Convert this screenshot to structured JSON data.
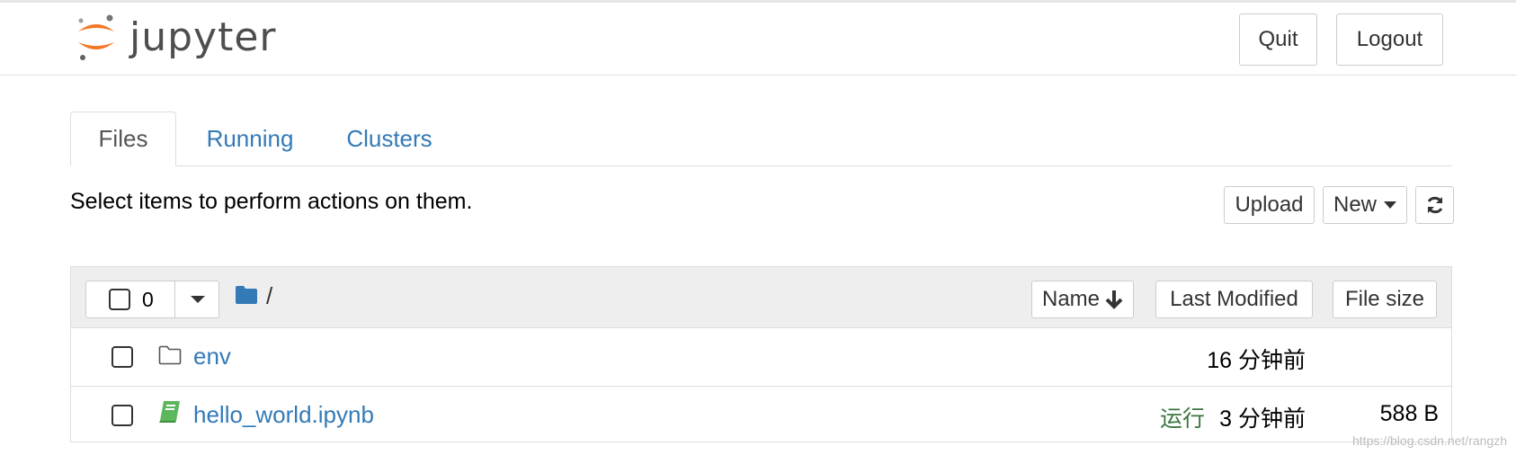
{
  "header": {
    "logo_text": "jupyter",
    "quit_label": "Quit",
    "logout_label": "Logout"
  },
  "tabs": [
    {
      "label": "Files",
      "active": true
    },
    {
      "label": "Running",
      "active": false
    },
    {
      "label": "Clusters",
      "active": false
    }
  ],
  "toolbar": {
    "select_text": "Select items to perform actions on them.",
    "upload_label": "Upload",
    "new_label": "New",
    "refresh_icon": "refresh-icon"
  },
  "list_header": {
    "selected_count": "0",
    "path": "/",
    "name_label": "Name",
    "last_modified_label": "Last Modified",
    "file_size_label": "File size"
  },
  "items": [
    {
      "name": "env",
      "type": "folder",
      "status": "",
      "modified": "16 分钟前",
      "size": ""
    },
    {
      "name": "hello_world.ipynb",
      "type": "notebook",
      "status": "运行",
      "modified": "3 分钟前",
      "size": "588 B"
    }
  ],
  "watermark": "https://blog.csdn.net/rangzh",
  "colors": {
    "link": "#337ab7",
    "running": "#3c763d",
    "notebook_icon": "#5cb85c",
    "folder": "#337ab7",
    "logo_orange": "#f37726",
    "header_bg": "#eeeeee"
  }
}
